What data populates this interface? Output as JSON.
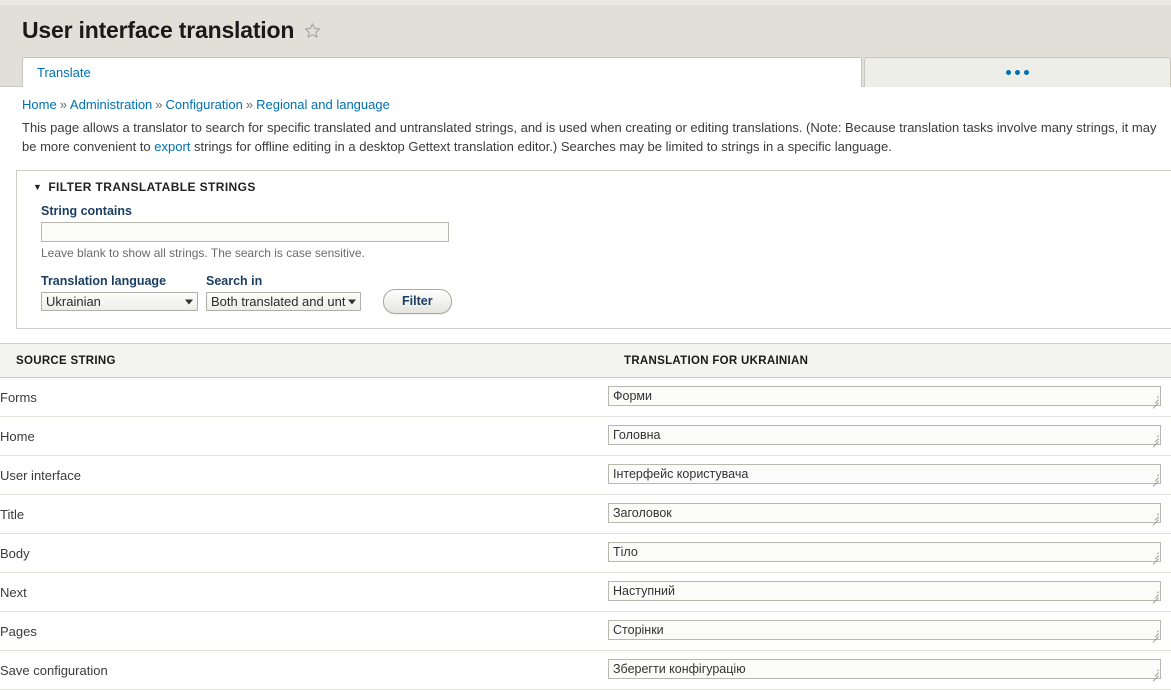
{
  "header": {
    "title": "User interface translation",
    "star_icon": "star-outline-icon"
  },
  "tabs": {
    "primary": "Translate",
    "overflow_icon": "ellipsis-icon"
  },
  "breadcrumb": {
    "items": [
      "Home",
      "Administration",
      "Configuration",
      "Regional and language"
    ],
    "separator": "»"
  },
  "intro": {
    "part1": "This page allows a translator to search for specific translated and untranslated strings, and is used when creating or editing translations. (Note: Because translation tasks involve many strings, it may be more convenient to ",
    "link": "export",
    "part2": " strings for offline editing in a desktop Gettext translation editor.) Searches may be limited to strings in a specific language."
  },
  "filter": {
    "legend": "FILTER TRANSLATABLE STRINGS",
    "caret": "▼",
    "string_contains_label": "String contains",
    "string_contains_value": "",
    "string_contains_placeholder": "",
    "string_contains_help": "Leave blank to show all strings. The search is case sensitive.",
    "language_label": "Translation language",
    "language_value": "Ukrainian",
    "search_in_label": "Search in",
    "search_in_value": "Both translated and unt",
    "filter_button": "Filter"
  },
  "table": {
    "headers": {
      "source": "SOURCE STRING",
      "translation": "TRANSLATION FOR UKRAINIAN"
    },
    "rows": [
      {
        "source": "Forms",
        "translation": "Форми"
      },
      {
        "source": "Home",
        "translation": "Головна"
      },
      {
        "source": "User interface",
        "translation": "Інтерфейс користувача"
      },
      {
        "source": "Title",
        "translation": "Заголовок"
      },
      {
        "source": "Body",
        "translation": "Тіло"
      },
      {
        "source": "Next",
        "translation": "Наступний"
      },
      {
        "source": "Pages",
        "translation": "Сторінки"
      },
      {
        "source": "Save configuration",
        "translation": "Зберегти конфігурацію"
      }
    ]
  },
  "colors": {
    "header_bg": "#e0e0d8",
    "link": "#0071b3",
    "table_header_bg": "#f3f4ef",
    "label": "#1b3f63"
  }
}
